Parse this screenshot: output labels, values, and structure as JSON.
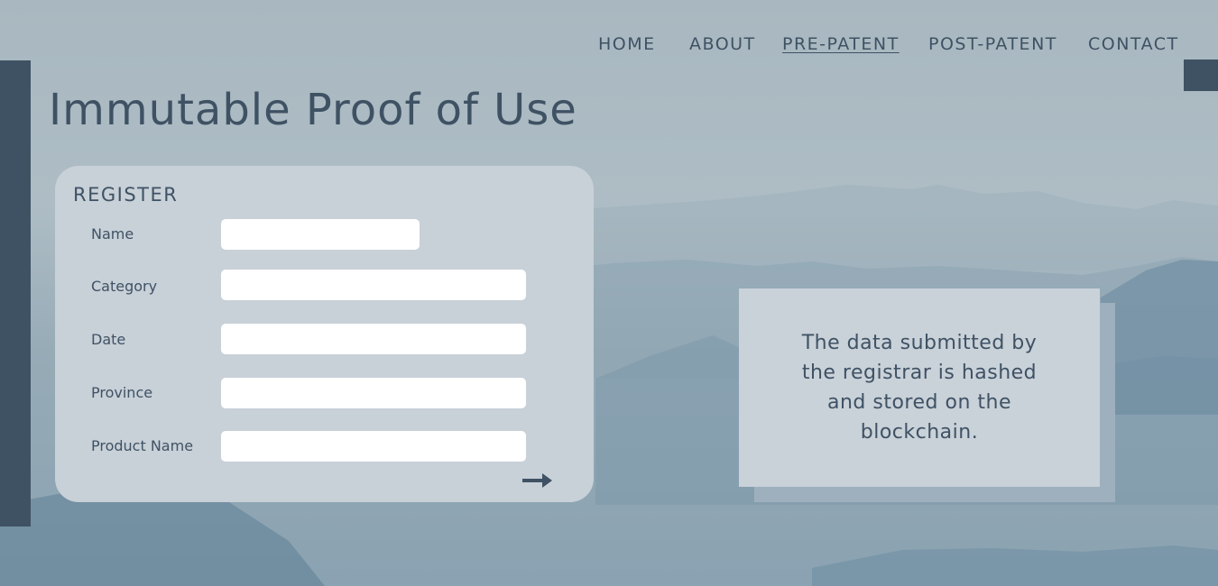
{
  "nav": {
    "items": [
      {
        "label": "HOME"
      },
      {
        "label": "ABOUT"
      },
      {
        "label": "PRE-PATENT"
      },
      {
        "label": "POST-PATENT"
      },
      {
        "label": "CONTACT"
      }
    ],
    "active": "PRE-PATENT"
  },
  "page": {
    "title": "Immutable Proof of Use"
  },
  "register": {
    "title": "REGISTER",
    "fields": [
      {
        "label": "Name",
        "value": ""
      },
      {
        "label": "Category",
        "value": ""
      },
      {
        "label": "Date",
        "value": ""
      },
      {
        "label": "Province",
        "value": ""
      },
      {
        "label": "Product Name",
        "value": ""
      }
    ],
    "submit_icon": "arrow-right-icon"
  },
  "info": {
    "text": "The data submitted by the registrar is hashed and stored on the blockchain."
  },
  "colors": {
    "primary": "#3f5264",
    "card": "#c8d0d8",
    "input": "#ffffff",
    "background": "#a9b8c0"
  }
}
